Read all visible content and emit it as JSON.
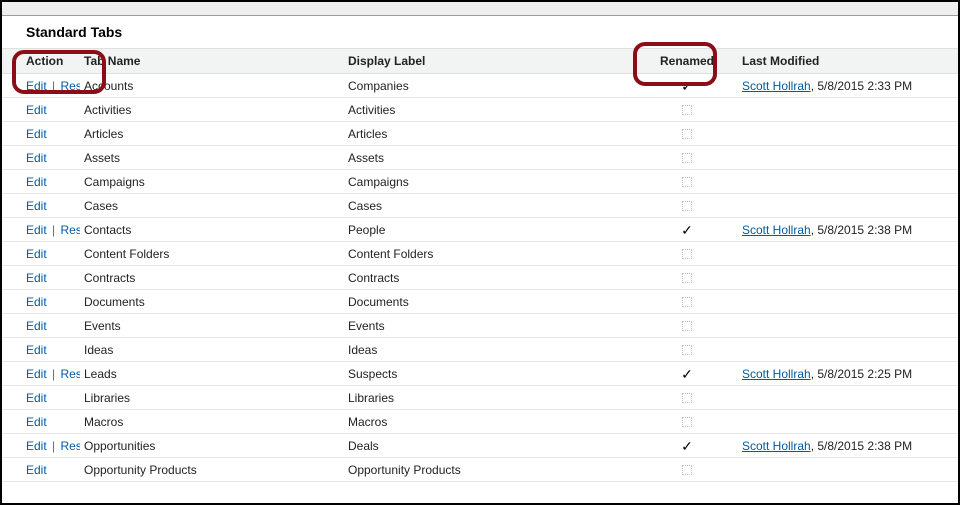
{
  "section_title": "Standard Tabs",
  "columns": {
    "action": "Action",
    "tab_name": "Tab Name",
    "display_label": "Display Label",
    "renamed": "Renamed",
    "last_modified": "Last Modified"
  },
  "labels": {
    "edit": "Edit",
    "reset": "Reset",
    "sep": "|"
  },
  "rows": [
    {
      "tab_name": "Accounts",
      "display_label": "Companies",
      "renamed": true,
      "has_reset": true,
      "modified_by": "Scott Hollrah",
      "modified_at": "5/8/2015 2:33 PM"
    },
    {
      "tab_name": "Activities",
      "display_label": "Activities",
      "renamed": false,
      "has_reset": false,
      "modified_by": "",
      "modified_at": ""
    },
    {
      "tab_name": "Articles",
      "display_label": "Articles",
      "renamed": false,
      "has_reset": false,
      "modified_by": "",
      "modified_at": ""
    },
    {
      "tab_name": "Assets",
      "display_label": "Assets",
      "renamed": false,
      "has_reset": false,
      "modified_by": "",
      "modified_at": ""
    },
    {
      "tab_name": "Campaigns",
      "display_label": "Campaigns",
      "renamed": false,
      "has_reset": false,
      "modified_by": "",
      "modified_at": ""
    },
    {
      "tab_name": "Cases",
      "display_label": "Cases",
      "renamed": false,
      "has_reset": false,
      "modified_by": "",
      "modified_at": ""
    },
    {
      "tab_name": "Contacts",
      "display_label": "People",
      "renamed": true,
      "has_reset": true,
      "modified_by": "Scott Hollrah",
      "modified_at": "5/8/2015 2:38 PM"
    },
    {
      "tab_name": "Content Folders",
      "display_label": "Content Folders",
      "renamed": false,
      "has_reset": false,
      "modified_by": "",
      "modified_at": ""
    },
    {
      "tab_name": "Contracts",
      "display_label": "Contracts",
      "renamed": false,
      "has_reset": false,
      "modified_by": "",
      "modified_at": ""
    },
    {
      "tab_name": "Documents",
      "display_label": "Documents",
      "renamed": false,
      "has_reset": false,
      "modified_by": "",
      "modified_at": ""
    },
    {
      "tab_name": "Events",
      "display_label": "Events",
      "renamed": false,
      "has_reset": false,
      "modified_by": "",
      "modified_at": ""
    },
    {
      "tab_name": "Ideas",
      "display_label": "Ideas",
      "renamed": false,
      "has_reset": false,
      "modified_by": "",
      "modified_at": ""
    },
    {
      "tab_name": "Leads",
      "display_label": "Suspects",
      "renamed": true,
      "has_reset": true,
      "modified_by": "Scott Hollrah",
      "modified_at": "5/8/2015 2:25 PM"
    },
    {
      "tab_name": "Libraries",
      "display_label": "Libraries",
      "renamed": false,
      "has_reset": false,
      "modified_by": "",
      "modified_at": ""
    },
    {
      "tab_name": "Macros",
      "display_label": "Macros",
      "renamed": false,
      "has_reset": false,
      "modified_by": "",
      "modified_at": ""
    },
    {
      "tab_name": "Opportunities",
      "display_label": "Deals",
      "renamed": true,
      "has_reset": true,
      "modified_by": "Scott Hollrah",
      "modified_at": "5/8/2015 2:38 PM"
    },
    {
      "tab_name": "Opportunity Products",
      "display_label": "Opportunity Products",
      "renamed": false,
      "has_reset": false,
      "modified_by": "",
      "modified_at": ""
    }
  ]
}
